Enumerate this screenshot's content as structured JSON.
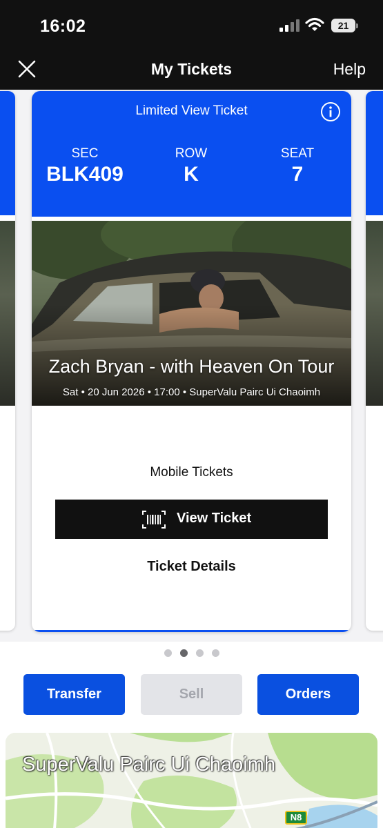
{
  "status_bar": {
    "time": "16:02",
    "battery": "21"
  },
  "nav": {
    "title": "My Tickets",
    "help_label": "Help"
  },
  "ticket": {
    "type_label": "Limited View Ticket",
    "section_label": "SEC",
    "section_value": "BLK409",
    "row_label": "ROW",
    "row_value": "K",
    "seat_label": "SEAT",
    "seat_value": "7"
  },
  "event": {
    "name": "Zach Bryan - with Heaven On Tour",
    "meta": "Sat • 20 Jun 2026 • 17:00 • SuperValu Pairc Ui Chaoimh"
  },
  "delivery": {
    "label": "Mobile Tickets",
    "view_ticket_label": "View Ticket",
    "details_label": "Ticket Details"
  },
  "carousel": {
    "page_count": 4,
    "active_index": 1
  },
  "actions": {
    "transfer_label": "Transfer",
    "sell_label": "Sell",
    "orders_label": "Orders"
  },
  "map": {
    "venue_name": "SuperValu Pairc Ui Chaoimh",
    "road_label": "N8"
  },
  "colors": {
    "accent": "#0a4ff0",
    "nav_bg": "#111111",
    "disabled": "#e3e4e8"
  },
  "icons": [
    "close-icon",
    "info-icon",
    "barcode-icon",
    "wifi-icon",
    "signal-icon",
    "battery-icon"
  ]
}
